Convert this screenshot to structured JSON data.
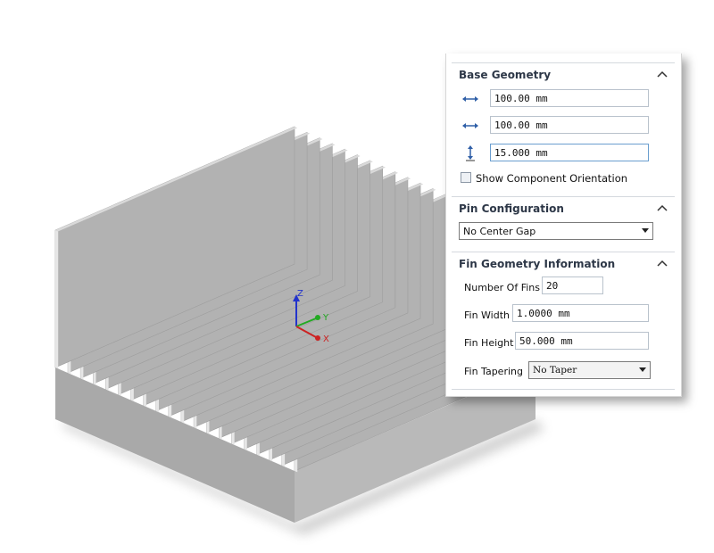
{
  "viewport": {
    "triad": {
      "x_label": "X",
      "y_label": "Y",
      "z_label": "Z"
    }
  },
  "panel": {
    "base_geometry": {
      "title": "Base Geometry",
      "length_value": "100.00 mm",
      "width_value": "100.00 mm",
      "height_value": "15.000 mm",
      "show_orientation_label": "Show Component Orientation",
      "show_orientation_checked": false
    },
    "pin_configuration": {
      "title": "Pin Configuration",
      "selected": "No Center Gap"
    },
    "fin_geometry": {
      "title": "Fin Geometry Information",
      "number_of_fins_label": "Number Of Fins",
      "number_of_fins_value": "20",
      "fin_width_label": "Fin Width",
      "fin_width_value": "1.0000 mm",
      "fin_height_label": "Fin Height",
      "fin_height_value": "50.000 mm",
      "fin_tapering_label": "Fin Tapering",
      "fin_tapering_value": "No Taper"
    }
  },
  "colors": {
    "fin_face": "#b2b2b2",
    "fin_edge": "#e6e6e6",
    "base_right": "#b9b9b9",
    "base_left": "#a9a9a9",
    "section_title": "#2d3747",
    "icon_blue": "#2f5fa7"
  }
}
